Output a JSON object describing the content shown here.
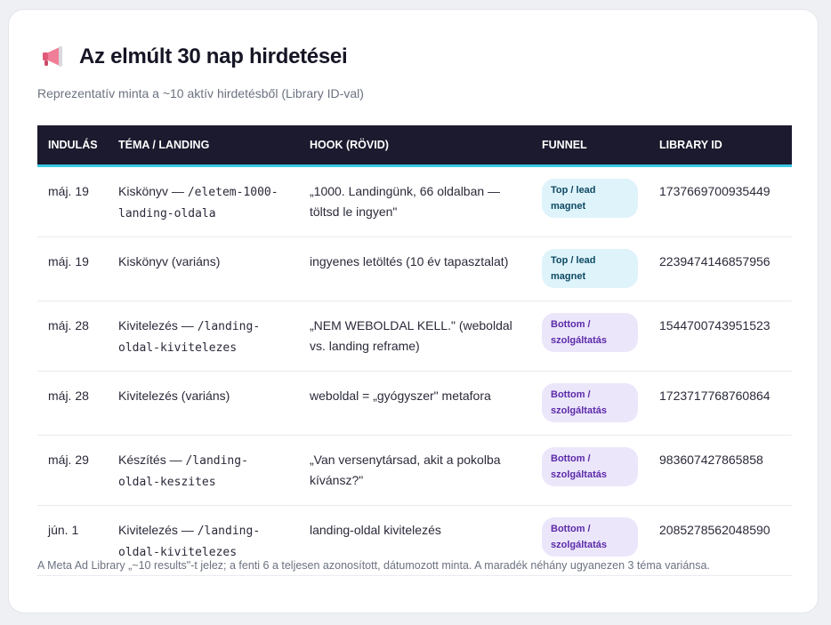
{
  "header": {
    "title": "Az elmúlt 30 nap hirdetései",
    "subtitle": "Reprezentatív minta a ~10 aktív hirdetésből (Library ID-val)"
  },
  "table": {
    "columns": [
      "INDULÁS",
      "TÉMA / LANDING",
      "HOOK (RÖVID)",
      "FUNNEL",
      "LIBRARY ID"
    ],
    "rows": [
      {
        "date": "máj. 19",
        "topic_text": "Kiskönyv — ",
        "topic_code": "/eletem-1000-landing-oldala",
        "hook": "„1000. Landingünk, 66 oldalban — töltsd le ingyen\"",
        "funnel": "Top / lead magnet",
        "funnel_type": "top",
        "library_id": "1737669700935449"
      },
      {
        "date": "máj. 19",
        "topic_text": "Kiskönyv (variáns)",
        "topic_code": "",
        "hook": "ingyenes letöltés (10 év tapasztalat)",
        "funnel": "Top / lead magnet",
        "funnel_type": "top",
        "library_id": "2239474146857956"
      },
      {
        "date": "máj. 28",
        "topic_text": "Kivitelezés — ",
        "topic_code": "/landing-oldal-kivitelezes",
        "hook": "„NEM WEBOLDAL KELL.\" (weboldal vs. landing reframe)",
        "funnel": "Bottom / szolgáltatás",
        "funnel_type": "bottom",
        "library_id": "1544700743951523"
      },
      {
        "date": "máj. 28",
        "topic_text": "Kivitelezés (variáns)",
        "topic_code": "",
        "hook": "weboldal = „gyógyszer\" metafora",
        "funnel": "Bottom / szolgáltatás",
        "funnel_type": "bottom",
        "library_id": "1723717768760864"
      },
      {
        "date": "máj. 29",
        "topic_text": "Készítés — ",
        "topic_code": "/landing-oldal-keszites",
        "hook": "„Van versenytársad, akit a pokolba kívánsz?\"",
        "funnel": "Bottom / szolgáltatás",
        "funnel_type": "bottom",
        "library_id": "983607427865858"
      },
      {
        "date": "jún. 1",
        "topic_text": "Kivitelezés — ",
        "topic_code": "/landing-oldal-kivitelezes",
        "hook": "landing-oldal kivitelezés",
        "funnel": "Bottom / szolgáltatás",
        "funnel_type": "bottom",
        "library_id": "2085278562048590"
      }
    ]
  },
  "footnote": "A Meta Ad Library „~10 results\"-t jelez; a fenti 6 a teljesen azonosított, dátumozott minta. A maradék néhány ugyanezen 3 téma variánsa.",
  "icons": {
    "title_icon": "megaphone-icon"
  },
  "colors": {
    "header_bg": "#1b1a2e",
    "header_accent": "#38c8e8",
    "badge_top_bg": "#dff3fb",
    "badge_top_text": "#0d4a63",
    "badge_bottom_bg": "#ece6fb",
    "badge_bottom_text": "#5b2aa8"
  }
}
